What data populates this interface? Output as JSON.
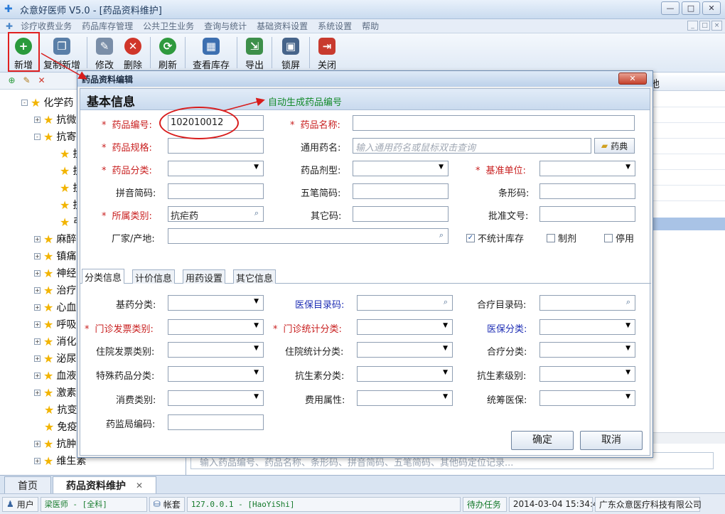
{
  "window": {
    "title": "众意好医师 V5.0 - [药品资料维护]",
    "controls": [
      "—",
      "□",
      "✕"
    ]
  },
  "menu": {
    "items": [
      "诊疗收费业务",
      "药品库存管理",
      "公共卫生业务",
      "查询与统计",
      "基础资料设置",
      "系统设置",
      "帮助"
    ],
    "mdi_controls": [
      "_",
      "□",
      "×"
    ]
  },
  "toolbar": {
    "new": "新增",
    "copy_new": "复制新增",
    "edit": "修改",
    "delete": "删除",
    "refresh": "刷新",
    "stock": "查看库存",
    "export": "导出",
    "lock": "锁屏",
    "close": "关闭"
  },
  "tree": {
    "items": [
      {
        "label": "化学药",
        "exp": "-"
      },
      {
        "label": "抗微",
        "exp": "+"
      },
      {
        "label": "抗寄",
        "exp": "-"
      },
      {
        "label": "抗",
        "exp": ""
      },
      {
        "label": "抗",
        "exp": ""
      },
      {
        "label": "抗",
        "exp": ""
      },
      {
        "label": "抗",
        "exp": ""
      },
      {
        "label": "弓",
        "exp": ""
      },
      {
        "label": "麻醉",
        "exp": "+"
      },
      {
        "label": "镇痛",
        "exp": "+"
      },
      {
        "label": "神经",
        "exp": "+"
      },
      {
        "label": "治疗",
        "exp": "+"
      },
      {
        "label": "心血",
        "exp": "+"
      },
      {
        "label": "呼吸",
        "exp": "+"
      },
      {
        "label": "消化",
        "exp": "+"
      },
      {
        "label": "泌尿",
        "exp": "+"
      },
      {
        "label": "血液",
        "exp": "+"
      },
      {
        "label": "激素",
        "exp": "+"
      },
      {
        "label": "抗变",
        "exp": ""
      },
      {
        "label": "免疫",
        "exp": ""
      },
      {
        "label": "抗肿",
        "exp": "+"
      },
      {
        "label": "维生素",
        "exp": "+"
      }
    ]
  },
  "list": {
    "column_partial": "地",
    "search_placeholder": "输入药品编号、药品名称、条形码、拼音简码、五笔简码、其他码定位记录..."
  },
  "tabs_bottom": {
    "home": "首页",
    "active": "药品资料维护",
    "close": "✕"
  },
  "status": {
    "user_label": "用户",
    "user_value": "梁医师 - [全科]",
    "account_label": "帐套",
    "account_value": "127.0.0.1 - [HaoYiShi]",
    "tasks": "待办任务",
    "datetime": "2014-03-04 15:34:43",
    "company": "广东众意医疗科技有限公司"
  },
  "dialog": {
    "title": "药品资料编辑",
    "close": "✕",
    "section": "基本信息",
    "auto_note": "自动生成药品编号",
    "required_mark": "*",
    "fields": {
      "code_label": "药品编号:",
      "code_value": "102010012",
      "name_label": "药品名称:",
      "spec_label": "药品规格:",
      "generic_label": "通用药名:",
      "generic_placeholder": "输入通用药名或鼠标双击查询",
      "dict_button": "药典",
      "category_label": "药品分类:",
      "form_label": "药品剂型:",
      "unit_label": "基准单位:",
      "pinyin_label": "拼音简码:",
      "wubi_label": "五笔简码:",
      "barcode_label": "条形码:",
      "belong_label": "所属类别:",
      "belong_value": "抗疟药",
      "other_code_label": "其它码:",
      "approval_label": "批准文号:",
      "maker_label": "厂家/产地:",
      "no_stock_label": "不统计库存",
      "no_stock_checked": true,
      "preparation_label": "制剂",
      "disabled_label": "停用"
    },
    "tabs": [
      "分类信息",
      "计价信息",
      "用药设置",
      "其它信息"
    ],
    "class_fields": {
      "essential": "基药分类:",
      "insurance_code": "医保目录码:",
      "coop_code": "合疗目录码:",
      "op_invoice": "门诊发票类别:",
      "op_stat": "门诊统计分类:",
      "insurance_class": "医保分类:",
      "ip_invoice": "住院发票类别:",
      "ip_stat": "住院统计分类:",
      "coop_class": "合疗分类:",
      "special": "特殊药品分类:",
      "antibiotic_class": "抗生素分类:",
      "antibiotic_level": "抗生素级别:",
      "consume": "消费类别:",
      "fee_attr": "费用属性:",
      "pooling": "统筹医保:",
      "fda_code": "药监局编码:"
    },
    "ok": "确定",
    "cancel": "取消"
  },
  "colors": {
    "required": "#c81e1e",
    "insurance_blue": "#1e2eb4",
    "note_green": "#138a2a",
    "highlight_red": "#d81c1c"
  }
}
